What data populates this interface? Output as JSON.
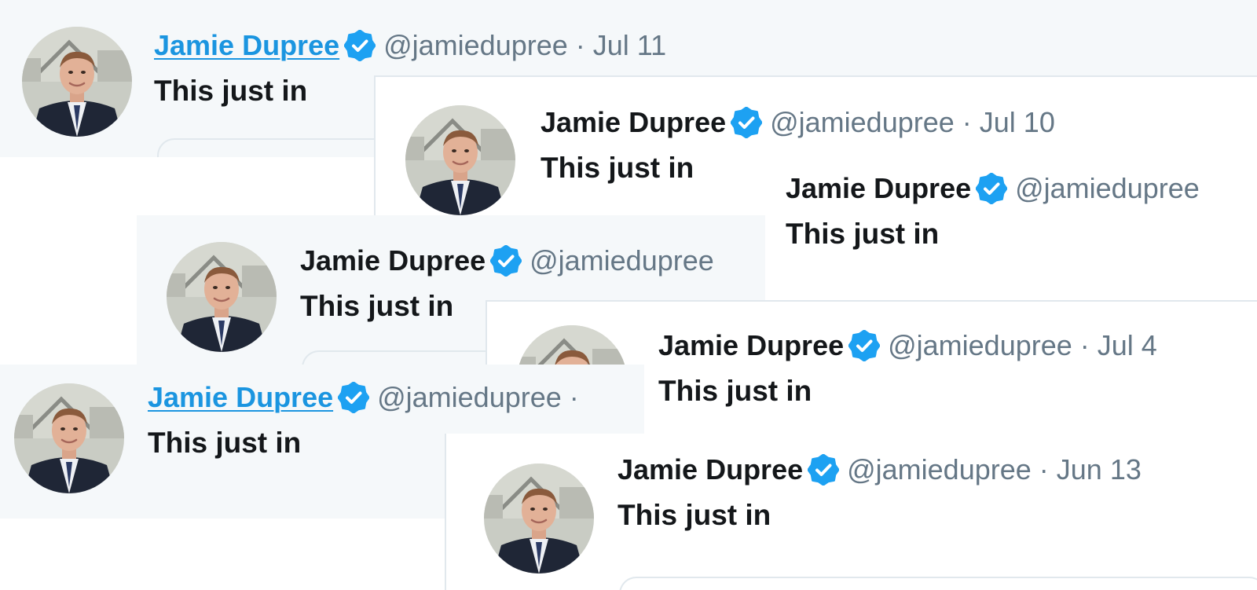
{
  "tweets": [
    {
      "name": "Jamie Dupree",
      "handle": "@jamiedupree",
      "separator": "·",
      "date": "Jul 11",
      "text": "This just in"
    },
    {
      "name": "Jamie Dupree",
      "handle": "@jamiedupree",
      "separator": "·",
      "date": "Jul 10",
      "text": "This just in"
    },
    {
      "name": "Jamie Dupree",
      "handle": "@jamiedupree",
      "separator": "",
      "date": "",
      "text": "This just in"
    },
    {
      "name": "Jamie Dupree",
      "handle": "@jamiedupree",
      "separator": "",
      "date": "",
      "text": "This just in"
    },
    {
      "name": "Jamie Dupree",
      "handle": "@jamiedupree",
      "separator": "·",
      "date": "Jul 4",
      "text": "This just in"
    },
    {
      "name": "Jamie Dupree",
      "handle": "@jamiedupree",
      "separator": "·",
      "date": "",
      "text": "This just in"
    },
    {
      "name": "Jamie Dupree",
      "handle": "@jamiedupree",
      "separator": "·",
      "date": "Jun 13",
      "text": "This just in"
    }
  ],
  "icons": {
    "verified": "verified-badge-icon",
    "avatar": "profile-photo"
  },
  "colors": {
    "verified_blue": "#1da1f2",
    "link_blue": "#1b95e0",
    "text_dark": "#14171a",
    "text_gray": "#657786",
    "card_light": "#f5f8fa",
    "border": "#e1e8ed"
  }
}
